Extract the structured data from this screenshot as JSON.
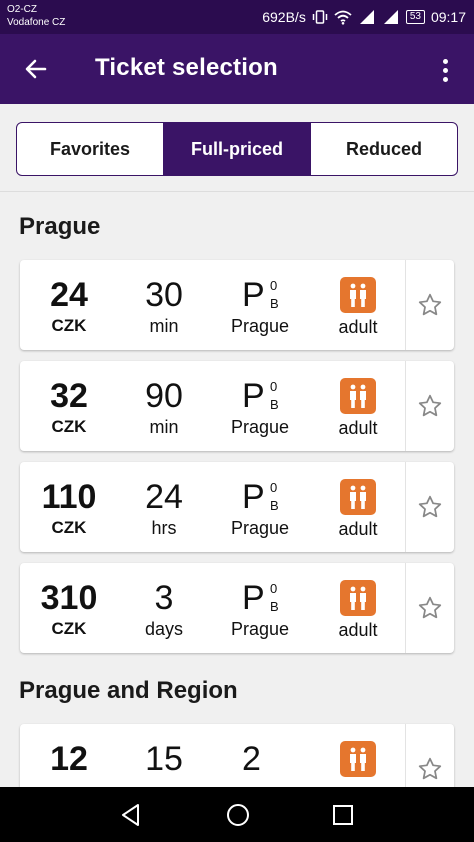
{
  "status_bar": {
    "carrier1": "O2-CZ",
    "carrier2": "Vodafone CZ",
    "speed": "692B/s",
    "battery": "53",
    "time": "09:17"
  },
  "app_bar": {
    "title": "Ticket selection"
  },
  "tabs": [
    {
      "label": "Favorites",
      "active": false
    },
    {
      "label": "Full-priced",
      "active": true
    },
    {
      "label": "Reduced",
      "active": false
    }
  ],
  "sections": [
    {
      "title": "Prague",
      "tickets": [
        {
          "price": "24",
          "currency": "CZK",
          "duration": "30",
          "unit": "min",
          "zone_main": "P",
          "zone_sup": "0",
          "zone_sub": "B",
          "zone_name": "Prague",
          "passenger": "adult"
        },
        {
          "price": "32",
          "currency": "CZK",
          "duration": "90",
          "unit": "min",
          "zone_main": "P",
          "zone_sup": "0",
          "zone_sub": "B",
          "zone_name": "Prague",
          "passenger": "adult"
        },
        {
          "price": "110",
          "currency": "CZK",
          "duration": "24",
          "unit": "hrs",
          "zone_main": "P",
          "zone_sup": "0",
          "zone_sub": "B",
          "zone_name": "Prague",
          "passenger": "adult"
        },
        {
          "price": "310",
          "currency": "CZK",
          "duration": "3",
          "unit": "days",
          "zone_main": "P",
          "zone_sup": "0",
          "zone_sub": "B",
          "zone_name": "Prague",
          "passenger": "adult"
        }
      ]
    },
    {
      "title": "Prague and Region",
      "tickets": [
        {
          "price": "12",
          "duration": "15",
          "zone_main": "2"
        }
      ]
    }
  ],
  "colors": {
    "primary": "#3a1466",
    "status_bar": "#2b0c4f",
    "accent": "#e5762e"
  },
  "icons": {
    "back": "arrow-left-icon",
    "menu": "more-vert-icon",
    "favorite": "star-outline-icon",
    "passenger": "adult-people-icon"
  }
}
